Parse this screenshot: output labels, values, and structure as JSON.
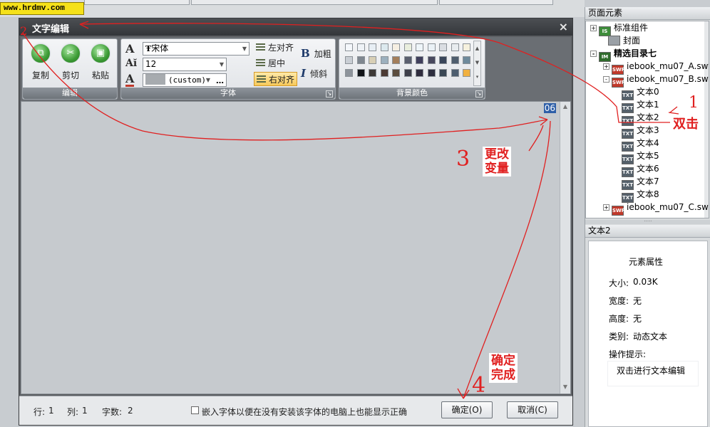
{
  "watermark": "www.hrdmv.com",
  "dialog": {
    "title": "文字编辑",
    "close_glyph": "×"
  },
  "ribbon": {
    "edit_group": {
      "label": "编辑",
      "copy": "复制",
      "cut": "剪切",
      "paste": "粘贴"
    },
    "font_group": {
      "label": "字体",
      "font_name": "宋体",
      "font_size": "12",
      "color_value": "(custom)",
      "align_left": "左对齐",
      "align_center": "居中",
      "align_right": "右对齐",
      "bold": "加粗",
      "italic": "倾斜",
      "bold_glyph": "B",
      "italic_glyph": "I"
    },
    "bg_group": {
      "label": "背景颜色",
      "swatches": [
        "#f4f7fb",
        "#eef2f6",
        "#e7eef4",
        "#dce9ee",
        "#f6efe2",
        "#e9eedd",
        "#eef5f9",
        "#eaf1f6",
        "#dadde2",
        "#e8ecef",
        "#f6f1de",
        "#c9ced4",
        "#7f8790",
        "#d8cfb6",
        "#9cb0be",
        "#a37e5b",
        "#5a5f6e",
        "#403f5c",
        "#49495e",
        "#3a465a",
        "#4f5e6e",
        "#6e8a9c",
        "#8d939b",
        "#111418",
        "#3e3a37",
        "#4b3a34",
        "#5a4c3e",
        "#3e3f4a",
        "#2f2c3e",
        "#2d2e3f",
        "#3a4755",
        "#4d5e70",
        "#f0b040"
      ]
    }
  },
  "editor": {
    "text": "06"
  },
  "status": {
    "row_label": "行:",
    "row_value": "1",
    "col_label": "列:",
    "col_value": "1",
    "chars_label": "字数:",
    "chars_value": "2",
    "embed_label": "嵌入字体以便在没有安装该字体的电脑上也能显示正确",
    "ok": "确定(O)",
    "cancel": "取消(C)"
  },
  "right_panel": {
    "title": "页面元素",
    "tree": [
      {
        "label": "标准组件",
        "icon": "component-icon",
        "expander": "+"
      },
      {
        "label": "封面",
        "icon": "page-icon",
        "expander": ""
      },
      {
        "label": "精选目录七",
        "icon": "catalog-icon",
        "expander": "-"
      },
      {
        "label": "iebook_mu07_A.swf",
        "icon": "swf-icon",
        "expander": "+"
      },
      {
        "label": "iebook_mu07_B.swf",
        "icon": "swf-icon",
        "expander": "-"
      },
      {
        "label": "文本0",
        "icon": "text-icon",
        "expander": ""
      },
      {
        "label": "文本1",
        "icon": "text-icon",
        "expander": ""
      },
      {
        "label": "文本2",
        "icon": "text-icon",
        "expander": ""
      },
      {
        "label": "文本3",
        "icon": "text-icon",
        "expander": ""
      },
      {
        "label": "文本4",
        "icon": "text-icon",
        "expander": ""
      },
      {
        "label": "文本5",
        "icon": "text-icon",
        "expander": ""
      },
      {
        "label": "文本6",
        "icon": "text-icon",
        "expander": ""
      },
      {
        "label": "文本7",
        "icon": "text-icon",
        "expander": ""
      },
      {
        "label": "文本8",
        "icon": "text-icon",
        "expander": ""
      },
      {
        "label": "iebook_mu07_C.swf",
        "icon": "swf-icon",
        "expander": "+"
      }
    ],
    "icon_text": {
      "component": "IS",
      "swf": "SWF",
      "text": "TXT",
      "catalog": "IM"
    },
    "props_title": "文本2",
    "props": {
      "heading": "元素属性",
      "size_label": "大小:",
      "size_value": "0.03K",
      "width_label": "宽度:",
      "width_value": "无",
      "height_label": "高度:",
      "height_value": "无",
      "type_label": "类别:",
      "type_value": "动态文本",
      "hint_label": "操作提示:",
      "hint_value": "双击进行文本编辑"
    }
  },
  "annotations": {
    "step1_num": "1",
    "step1_text": "双击",
    "step2_num": "2",
    "step3_num": "3",
    "step3_text_line1": "更改",
    "step3_text_line2": "变量",
    "step4_num": "4",
    "step4_text_line1": "确定",
    "step4_text_line2": "完成",
    "color": "#e02020"
  }
}
